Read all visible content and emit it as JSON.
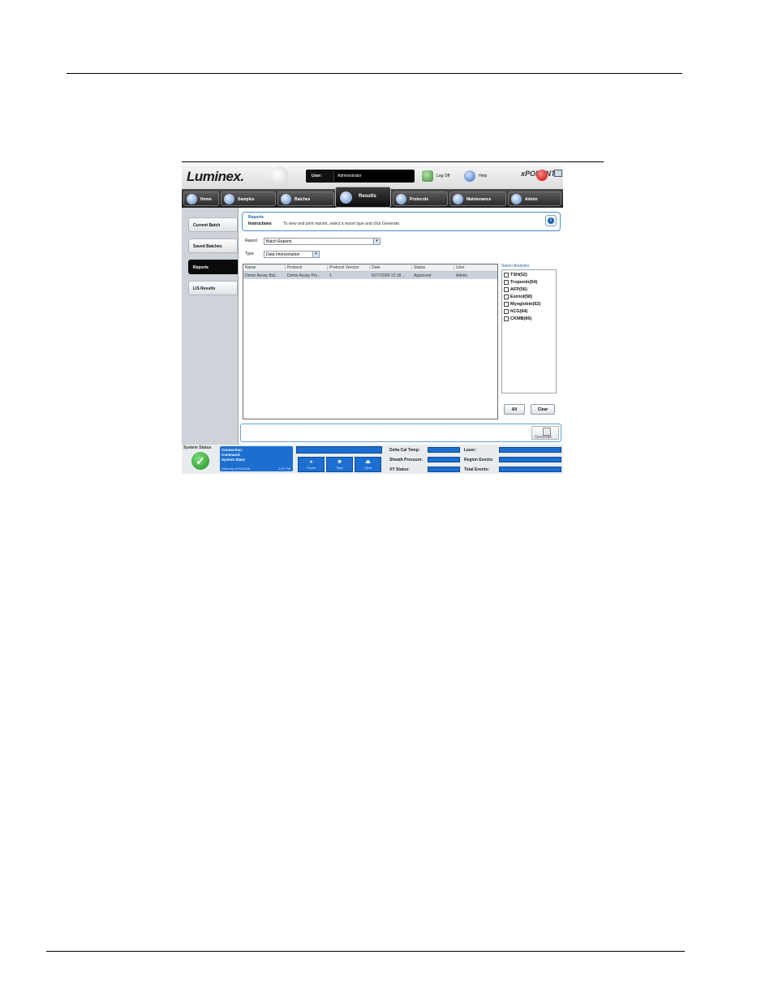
{
  "header": {
    "logo": "Luminex.",
    "user_label": "User:",
    "user_value": "Administrator",
    "logoff_label": "Log Off",
    "help_label": "Help",
    "brand": "xPONENT"
  },
  "nav": {
    "tabs": [
      {
        "label": "Home"
      },
      {
        "label": "Samples"
      },
      {
        "label": "Batches"
      },
      {
        "label": "Results"
      },
      {
        "label": "Protocols"
      },
      {
        "label": "Maintenance"
      },
      {
        "label": "Admin"
      }
    ],
    "active": "Results"
  },
  "sidebar": {
    "items": [
      {
        "label": "Current Batch"
      },
      {
        "label": "Saved Batches"
      },
      {
        "label": "Reports"
      },
      {
        "label": "LIS Results"
      }
    ],
    "active": "Reports"
  },
  "instructions": {
    "title": "Reports",
    "subtitle": "Instructions",
    "text": "To view and print reports, select a report type and click Generate."
  },
  "form": {
    "report_label": "Report",
    "report_value": "Batch Reports",
    "type_label": "Type",
    "type_value": "Data Interpretation"
  },
  "table": {
    "columns": [
      "Name",
      "Protocol",
      "Protocol Version",
      "Date",
      "Status",
      "User"
    ],
    "rows": [
      [
        "Demo Assay Bat...",
        "Demo Assay Pro...",
        "1",
        "6/27/2008 12:18 ...",
        "Approved",
        "Admin"
      ]
    ]
  },
  "analytes": {
    "title": "Select Analytes",
    "items": [
      {
        "label": "TSH(52)"
      },
      {
        "label": "Troponin(54)"
      },
      {
        "label": "AFP(56)"
      },
      {
        "label": "Estriol(58)"
      },
      {
        "label": "Myoglobin(62)"
      },
      {
        "label": "hCG(64)"
      },
      {
        "label": "CKMB(66)"
      }
    ],
    "all_label": "All",
    "clear_label": "Clear"
  },
  "generate_label": "Generate",
  "status": {
    "title": "System Status",
    "connection_label": "Connection:",
    "command_label": "Command:",
    "system_state_label": "System State:",
    "date": "Saturday 8/30/2008",
    "time": "2:41 PM",
    "controls": [
      {
        "label": "Pause",
        "glyph": "⏸"
      },
      {
        "label": "Stop",
        "glyph": "■"
      },
      {
        "label": "Eject",
        "glyph": "⏏"
      }
    ],
    "metrics": {
      "delta_cal_temp": "Delta Cal Temp:",
      "sheath_pressure": "Sheath Pressure:",
      "xy_status": "XY Status:",
      "laser": "Laser:",
      "region_events": "Region Events:",
      "total_events": "Total Events:"
    }
  },
  "colors": {
    "accent_blue": "#1c6fd0",
    "status_green": "#1b8a22",
    "nav_dark": "#1e1e1e"
  },
  "icons": [
    "home-icon",
    "samples-icon",
    "batches-icon",
    "results-icon",
    "protocols-icon",
    "maintenance-icon",
    "admin-icon",
    "logoff-icon",
    "help-icon",
    "info-icon",
    "generate-icon",
    "status-ok-icon"
  ]
}
